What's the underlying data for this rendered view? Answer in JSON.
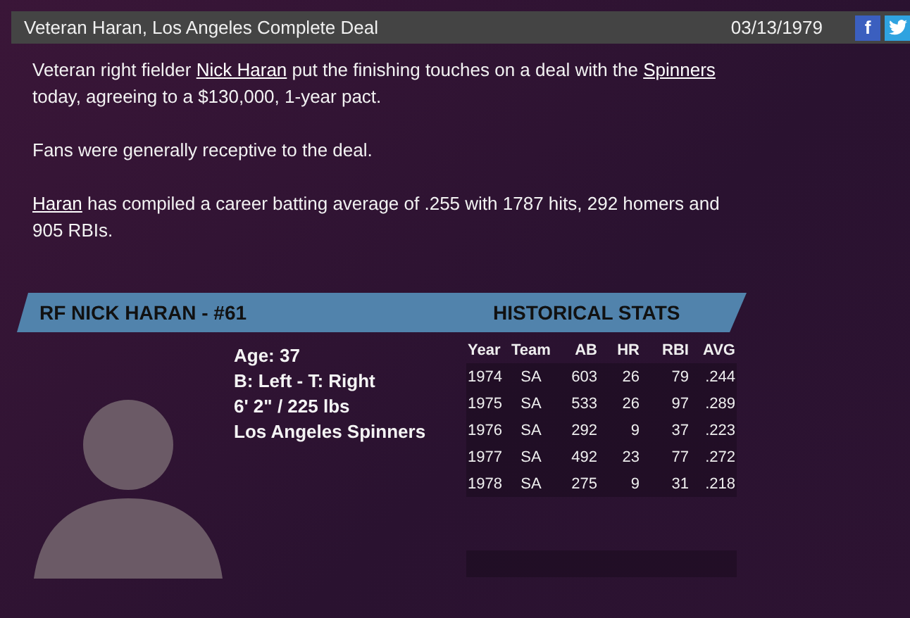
{
  "header": {
    "title": "Veteran Haran, Los Angeles Complete Deal",
    "date": "03/13/1979",
    "share_buttons": [
      {
        "kind": "facebook",
        "label": "f"
      },
      {
        "kind": "twitter"
      }
    ]
  },
  "article": {
    "paragraphs": [
      [
        {
          "text": "Veteran right fielder "
        },
        {
          "link": "Nick Haran"
        },
        {
          "text": " put the finishing touches on a deal with the "
        },
        {
          "link": "Spinners"
        },
        {
          "text": " today, agreeing to a $130,000, 1-year pact."
        }
      ],
      [
        {
          "text": "Fans were generally receptive to the deal."
        }
      ],
      [
        {
          "link": "Haran"
        },
        {
          "text": " has compiled a career batting average of .255 with 1787 hits, 292 homers and 905 RBIs."
        }
      ]
    ]
  },
  "player_card": {
    "title": "RF NICK HARAN - #61",
    "details": [
      "Age: 37",
      "B: Left - T: Right",
      "6' 2\" / 225 lbs",
      "Los Angeles Spinners"
    ],
    "stats": {
      "title": "HISTORICAL STATS",
      "columns": [
        "Year",
        "Team",
        "AB",
        "HR",
        "RBI",
        "AVG"
      ],
      "rows": [
        [
          "1974",
          "SA",
          "603",
          "26",
          "79",
          ".244"
        ],
        [
          "1975",
          "SA",
          "533",
          "26",
          "97",
          ".289"
        ],
        [
          "1976",
          "SA",
          "292",
          "9",
          "37",
          ".223"
        ],
        [
          "1977",
          "SA",
          "492",
          "23",
          "77",
          ".272"
        ],
        [
          "1978",
          "SA",
          "275",
          "9",
          "31",
          ".218"
        ]
      ]
    }
  }
}
